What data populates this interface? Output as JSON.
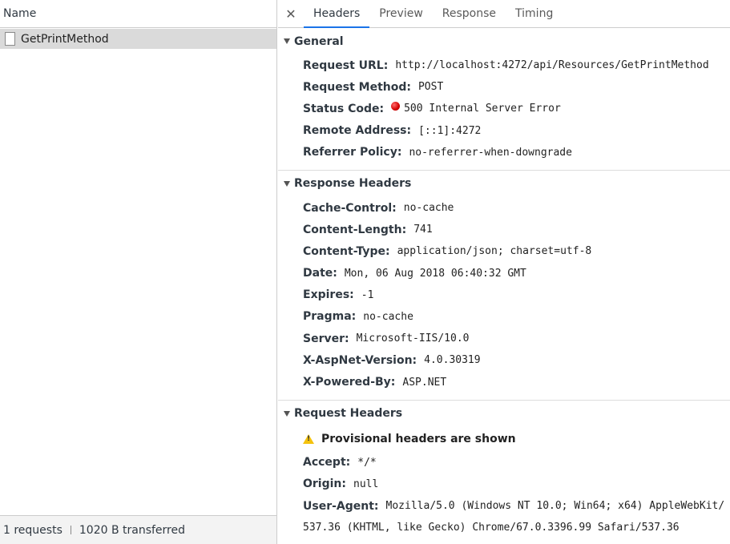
{
  "left": {
    "column_header": "Name",
    "requests": [
      {
        "name": "GetPrintMethod"
      }
    ],
    "footer": {
      "requests": "1 requests",
      "transferred": "1020 B transferred"
    }
  },
  "tabs": {
    "close_icon": "close-icon",
    "items": [
      "Headers",
      "Preview",
      "Response",
      "Timing"
    ],
    "active": "Headers"
  },
  "general": {
    "title": "General",
    "rows": [
      {
        "key": "Request URL:",
        "value": "http://localhost:4272/api/Resources/GetPrintMethod"
      },
      {
        "key": "Request Method:",
        "value": "POST"
      },
      {
        "key": "Status Code:",
        "value": "500 Internal Server Error"
      },
      {
        "key": "Remote Address:",
        "value": "[::1]:4272"
      },
      {
        "key": "Referrer Policy:",
        "value": "no-referrer-when-downgrade"
      }
    ]
  },
  "response_headers": {
    "title": "Response Headers",
    "rows": [
      {
        "key": "Cache-Control:",
        "value": "no-cache"
      },
      {
        "key": "Content-Length:",
        "value": "741"
      },
      {
        "key": "Content-Type:",
        "value": "application/json; charset=utf-8"
      },
      {
        "key": "Date:",
        "value": "Mon, 06 Aug 2018 06:40:32 GMT"
      },
      {
        "key": "Expires:",
        "value": "-1"
      },
      {
        "key": "Pragma:",
        "value": "no-cache"
      },
      {
        "key": "Server:",
        "value": "Microsoft-IIS/10.0"
      },
      {
        "key": "X-AspNet-Version:",
        "value": "4.0.30319"
      },
      {
        "key": "X-Powered-By:",
        "value": "ASP.NET"
      }
    ]
  },
  "request_headers": {
    "title": "Request Headers",
    "warning": "Provisional headers are shown",
    "rows": [
      {
        "key": "Accept:",
        "value": "*/*"
      },
      {
        "key": "Origin:",
        "value": "null"
      },
      {
        "key": "User-Agent:",
        "value": "Mozilla/5.0 (Windows NT 10.0; Win64; x64) AppleWebKit/"
      }
    ],
    "user_agent_continuation": "537.36 (KHTML, like Gecko) Chrome/67.0.3396.99 Safari/537.36"
  },
  "colors": {
    "status_error": "#d40000",
    "active_tab": "#1a73e8",
    "warning": "#f4c20d"
  }
}
